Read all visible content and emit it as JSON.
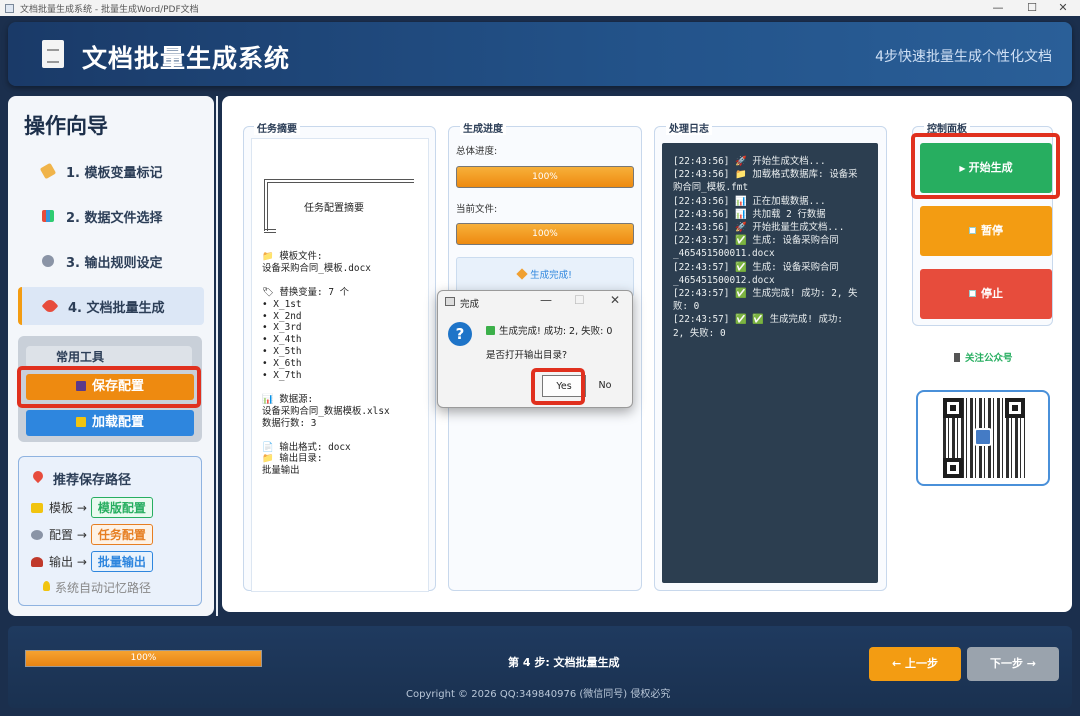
{
  "window": {
    "title": "文档批量生成系统 - 批量生成Word/PDF文档",
    "controls": [
      "—",
      "☐",
      "✕"
    ]
  },
  "header": {
    "title": "文档批量生成系统",
    "subtitle": "4步快速批量生成个性化文档"
  },
  "sidebar": {
    "title": "操作向导",
    "steps": [
      {
        "label": "1. 模板变量标记",
        "icon": "tag-icon"
      },
      {
        "label": "2. 数据文件选择",
        "icon": "bar-chart-icon"
      },
      {
        "label": "3. 输出规则设定",
        "icon": "gear-icon"
      },
      {
        "label": "4. 文档批量生成",
        "icon": "rocket-icon",
        "active": true
      }
    ],
    "tools": {
      "title": "常用工具",
      "save_label": "保存配置",
      "load_label": "加载配置"
    },
    "paths": {
      "title": "推荐保存路径",
      "rows": [
        {
          "label": "模板 →",
          "tag": "模版配置",
          "color": "#27ae60"
        },
        {
          "label": "配置 →",
          "tag": "任务配置",
          "color": "#e67e22"
        },
        {
          "label": "输出 →",
          "tag": "批量输出",
          "color": "#2e86de"
        }
      ],
      "hint": "系统自动记忆路径"
    }
  },
  "summary": {
    "group_label": "任务摘要",
    "frame_label": "任务配置摘要",
    "text": "📁 模板文件:\n设备采购合同_模板.docx\n\n🏷 替换变量: 7 个\n• X_1st\n• X_2nd\n• X_3rd\n• X_4th\n• X_5th\n• X_6th\n• X_7th\n\n📊 数据源:\n设备采购合同_数据模板.xlsx\n数据行数: 3\n\n📄 输出格式: docx\n📁 输出目录:\n批量输出"
  },
  "progress": {
    "group_label": "生成进度",
    "total_label": "总体进度:",
    "total_value": "100%",
    "total_fraction": 1.0,
    "current_label": "当前文件:",
    "current_value": "100%",
    "current_fraction": 1.0,
    "done_label": "生成完成!"
  },
  "log": {
    "group_label": "处理日志",
    "text": "[22:43:56] 🚀 开始生成文档...\n[22:43:56] 📁 加载格式数据库: 设备采\n购合同_模板.fmt\n[22:43:56] 📊 正在加载数据...\n[22:43:56] 📊 共加载 2 行数据\n[22:43:56] 🚀 开始批量生成文档...\n[22:43:57] ✅ 生成: 设备采购合同\n_465451500011.docx\n[22:43:57] ✅ 生成: 设备采购合同\n_465451500012.docx\n[22:43:57] ✅ 生成完成! 成功: 2, 失\n败: 0\n[22:43:57] ✅ ✅ 生成完成! 成功:\n2, 失败: 0"
  },
  "control": {
    "group_label": "控制面板",
    "start_label": "开始生成",
    "pause_label": "暂停",
    "stop_label": "停止",
    "follow_label": "关注公众号"
  },
  "dialog": {
    "title": "完成",
    "message": "生成完成! 成功: 2, 失败: 0",
    "question": "是否打开输出目录?",
    "yes_label": "Yes",
    "no_label": "No"
  },
  "footer": {
    "progress_value": "100%",
    "progress_fraction": 1.0,
    "step_text": "第 4 步: 文档批量生成",
    "prev_label": "← 上一步",
    "next_label": "下一步 →",
    "copyright": "Copyright © 2026 QQ:349840976 (微信同号) 侵权必究"
  },
  "colors": {
    "accent": "#f39c12",
    "start": "#27ae60",
    "pause": "#f39c12",
    "stop": "#e74c3c",
    "highlight": "#e0301e"
  }
}
